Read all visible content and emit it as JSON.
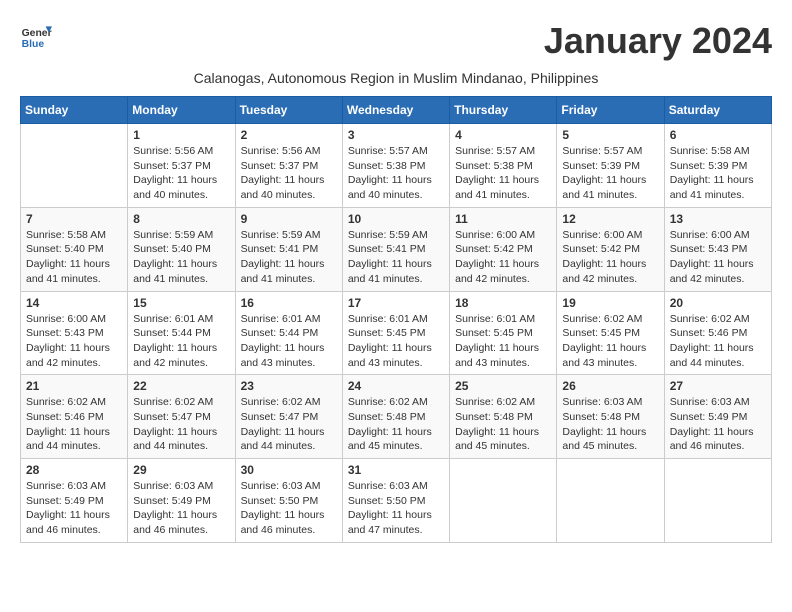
{
  "header": {
    "logo_general": "General",
    "logo_blue": "Blue",
    "month_title": "January 2024",
    "subtitle": "Calanogas, Autonomous Region in Muslim Mindanao, Philippines"
  },
  "weekdays": [
    "Sunday",
    "Monday",
    "Tuesday",
    "Wednesday",
    "Thursday",
    "Friday",
    "Saturday"
  ],
  "weeks": [
    [
      {
        "day": "",
        "info": ""
      },
      {
        "day": "1",
        "info": "Sunrise: 5:56 AM\nSunset: 5:37 PM\nDaylight: 11 hours and 40 minutes."
      },
      {
        "day": "2",
        "info": "Sunrise: 5:56 AM\nSunset: 5:37 PM\nDaylight: 11 hours and 40 minutes."
      },
      {
        "day": "3",
        "info": "Sunrise: 5:57 AM\nSunset: 5:38 PM\nDaylight: 11 hours and 40 minutes."
      },
      {
        "day": "4",
        "info": "Sunrise: 5:57 AM\nSunset: 5:38 PM\nDaylight: 11 hours and 41 minutes."
      },
      {
        "day": "5",
        "info": "Sunrise: 5:57 AM\nSunset: 5:39 PM\nDaylight: 11 hours and 41 minutes."
      },
      {
        "day": "6",
        "info": "Sunrise: 5:58 AM\nSunset: 5:39 PM\nDaylight: 11 hours and 41 minutes."
      }
    ],
    [
      {
        "day": "7",
        "info": "Sunrise: 5:58 AM\nSunset: 5:40 PM\nDaylight: 11 hours and 41 minutes."
      },
      {
        "day": "8",
        "info": "Sunrise: 5:59 AM\nSunset: 5:40 PM\nDaylight: 11 hours and 41 minutes."
      },
      {
        "day": "9",
        "info": "Sunrise: 5:59 AM\nSunset: 5:41 PM\nDaylight: 11 hours and 41 minutes."
      },
      {
        "day": "10",
        "info": "Sunrise: 5:59 AM\nSunset: 5:41 PM\nDaylight: 11 hours and 41 minutes."
      },
      {
        "day": "11",
        "info": "Sunrise: 6:00 AM\nSunset: 5:42 PM\nDaylight: 11 hours and 42 minutes."
      },
      {
        "day": "12",
        "info": "Sunrise: 6:00 AM\nSunset: 5:42 PM\nDaylight: 11 hours and 42 minutes."
      },
      {
        "day": "13",
        "info": "Sunrise: 6:00 AM\nSunset: 5:43 PM\nDaylight: 11 hours and 42 minutes."
      }
    ],
    [
      {
        "day": "14",
        "info": "Sunrise: 6:00 AM\nSunset: 5:43 PM\nDaylight: 11 hours and 42 minutes."
      },
      {
        "day": "15",
        "info": "Sunrise: 6:01 AM\nSunset: 5:44 PM\nDaylight: 11 hours and 42 minutes."
      },
      {
        "day": "16",
        "info": "Sunrise: 6:01 AM\nSunset: 5:44 PM\nDaylight: 11 hours and 43 minutes."
      },
      {
        "day": "17",
        "info": "Sunrise: 6:01 AM\nSunset: 5:45 PM\nDaylight: 11 hours and 43 minutes."
      },
      {
        "day": "18",
        "info": "Sunrise: 6:01 AM\nSunset: 5:45 PM\nDaylight: 11 hours and 43 minutes."
      },
      {
        "day": "19",
        "info": "Sunrise: 6:02 AM\nSunset: 5:45 PM\nDaylight: 11 hours and 43 minutes."
      },
      {
        "day": "20",
        "info": "Sunrise: 6:02 AM\nSunset: 5:46 PM\nDaylight: 11 hours and 44 minutes."
      }
    ],
    [
      {
        "day": "21",
        "info": "Sunrise: 6:02 AM\nSunset: 5:46 PM\nDaylight: 11 hours and 44 minutes."
      },
      {
        "day": "22",
        "info": "Sunrise: 6:02 AM\nSunset: 5:47 PM\nDaylight: 11 hours and 44 minutes."
      },
      {
        "day": "23",
        "info": "Sunrise: 6:02 AM\nSunset: 5:47 PM\nDaylight: 11 hours and 44 minutes."
      },
      {
        "day": "24",
        "info": "Sunrise: 6:02 AM\nSunset: 5:48 PM\nDaylight: 11 hours and 45 minutes."
      },
      {
        "day": "25",
        "info": "Sunrise: 6:02 AM\nSunset: 5:48 PM\nDaylight: 11 hours and 45 minutes."
      },
      {
        "day": "26",
        "info": "Sunrise: 6:03 AM\nSunset: 5:48 PM\nDaylight: 11 hours and 45 minutes."
      },
      {
        "day": "27",
        "info": "Sunrise: 6:03 AM\nSunset: 5:49 PM\nDaylight: 11 hours and 46 minutes."
      }
    ],
    [
      {
        "day": "28",
        "info": "Sunrise: 6:03 AM\nSunset: 5:49 PM\nDaylight: 11 hours and 46 minutes."
      },
      {
        "day": "29",
        "info": "Sunrise: 6:03 AM\nSunset: 5:49 PM\nDaylight: 11 hours and 46 minutes."
      },
      {
        "day": "30",
        "info": "Sunrise: 6:03 AM\nSunset: 5:50 PM\nDaylight: 11 hours and 46 minutes."
      },
      {
        "day": "31",
        "info": "Sunrise: 6:03 AM\nSunset: 5:50 PM\nDaylight: 11 hours and 47 minutes."
      },
      {
        "day": "",
        "info": ""
      },
      {
        "day": "",
        "info": ""
      },
      {
        "day": "",
        "info": ""
      }
    ]
  ]
}
